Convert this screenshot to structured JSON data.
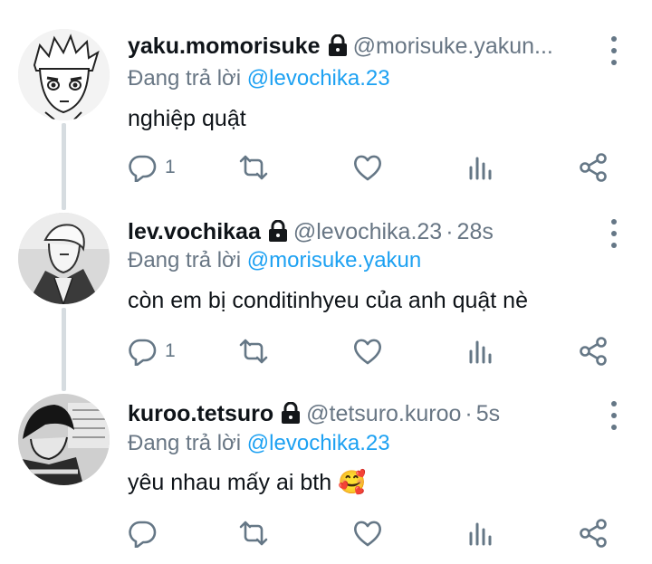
{
  "tweets": [
    {
      "name": "yaku.momorisuke",
      "handle": "@morisuke.yakun...",
      "time": "",
      "replying_prefix": "Đang trả lời",
      "replying_to": "@levochika.23",
      "text": "nghiệp quật",
      "reply_count": "1",
      "avatar_icon": "manga-character-avatar"
    },
    {
      "name": "lev.vochikaa",
      "handle": "@levochika.23",
      "time": "28s",
      "replying_prefix": "Đang trả lời",
      "replying_to": "@morisuke.yakun",
      "text": "còn em bị conditinhyeu của anh quật nè",
      "reply_count": "1",
      "avatar_icon": "manga-character-avatar"
    },
    {
      "name": "kuroo.tetsuro",
      "handle": "@tetsuro.kuroo",
      "time": "5s",
      "replying_prefix": "Đang trả lời",
      "replying_to": "@levochika.23",
      "text": "yêu nhau mấy ai bth",
      "emoji": "🥰",
      "reply_count": "",
      "avatar_icon": "manga-character-avatar"
    }
  ],
  "colors": {
    "mention": "#1da1f2",
    "muted": "#687684",
    "icon": "#657786",
    "thread_line": "#d6dce0"
  },
  "icons": [
    "lock-icon",
    "more-options-icon",
    "reply-icon",
    "retweet-icon",
    "like-icon",
    "analytics-icon",
    "share-icon"
  ]
}
